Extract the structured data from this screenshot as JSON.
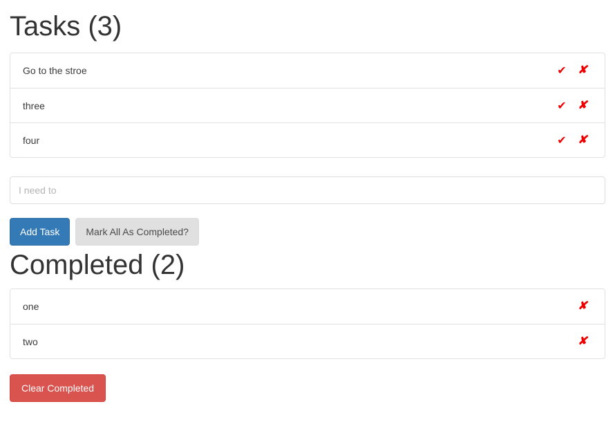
{
  "tasks_section": {
    "heading": "Tasks (3)",
    "items": [
      {
        "label": "Go to the stroe",
        "complete_icon": "check-icon",
        "delete_icon": "x-icon"
      },
      {
        "label": "three",
        "complete_icon": "check-icon",
        "delete_icon": "x-icon"
      },
      {
        "label": "four",
        "complete_icon": "check-icon",
        "delete_icon": "x-icon"
      }
    ],
    "icons": {
      "complete_glyph": "✔",
      "delete_glyph": "✘"
    }
  },
  "form": {
    "input_value": "",
    "input_placeholder": "I need to",
    "add_button_label": "Add Task",
    "mark_all_button_label": "Mark All As Completed?"
  },
  "completed_section": {
    "heading": "Completed (2)",
    "items": [
      {
        "label": "one",
        "delete_icon": "x-icon"
      },
      {
        "label": "two",
        "delete_icon": "x-icon"
      }
    ],
    "clear_button_label": "Clear Completed",
    "icons": {
      "delete_glyph": "✘"
    }
  },
  "colors": {
    "icon_red": "#ee0000",
    "primary_blue": "#337ab7",
    "default_gray": "#e0e0e0",
    "danger_red": "#d9534f",
    "heading_text": "#333333",
    "border": "#e0e0e0"
  }
}
